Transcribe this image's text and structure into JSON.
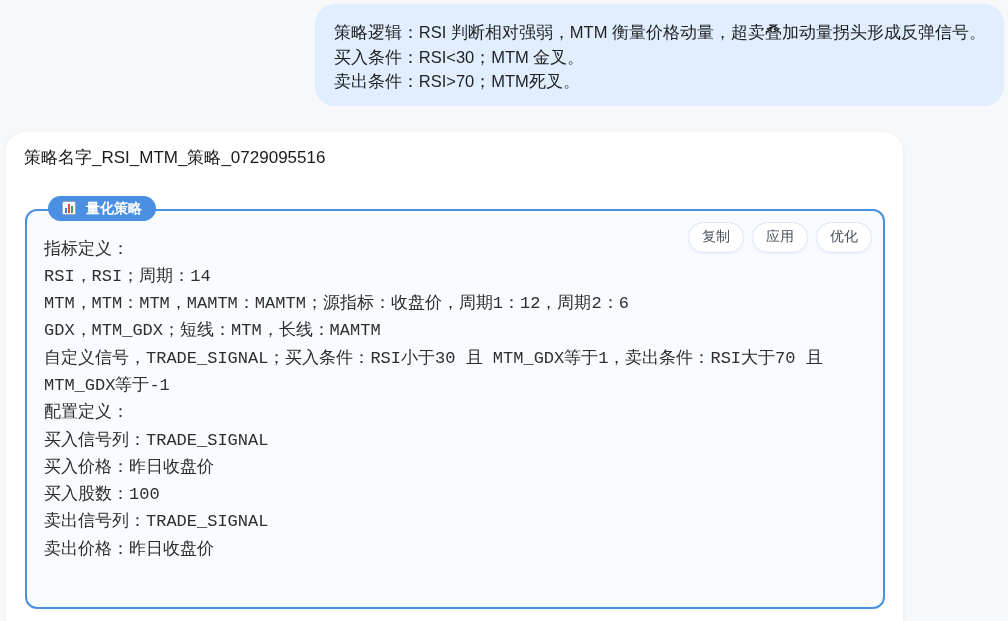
{
  "user_message": {
    "lines": [
      "策略逻辑：RSI 判断相对强弱，MTM 衡量价格动量，超卖叠加动量拐头形成反弹信号。",
      "买入条件：RSI<30；MTM 金叉。",
      "卖出条件：RSI>70；MTM死叉。"
    ]
  },
  "response": {
    "title": "策略名字_RSI_MTM_策略_0729095516",
    "strategy_block": {
      "badge": "量化策略",
      "buttons": [
        "复制",
        "应用",
        "优化"
      ],
      "lines": [
        "指标定义：",
        "RSI，RSI；周期：14",
        "MTM，MTM：MTM，MAMTM：MAMTM；源指标：收盘价，周期1：12，周期2：6",
        "GDX，MTM_GDX；短线：MTM，长线：MAMTM",
        "自定义信号，TRADE_SIGNAL；买入条件：RSI小于30 且 MTM_GDX等于1，卖出条件：RSI大于70 且 MTM_GDX等于-1",
        "配置定义：",
        "买入信号列：TRADE_SIGNAL",
        "买入价格：昨日收盘价",
        "买入股数：100",
        "卖出信号列：TRADE_SIGNAL",
        "卖出价格：昨日收盘价"
      ]
    }
  }
}
